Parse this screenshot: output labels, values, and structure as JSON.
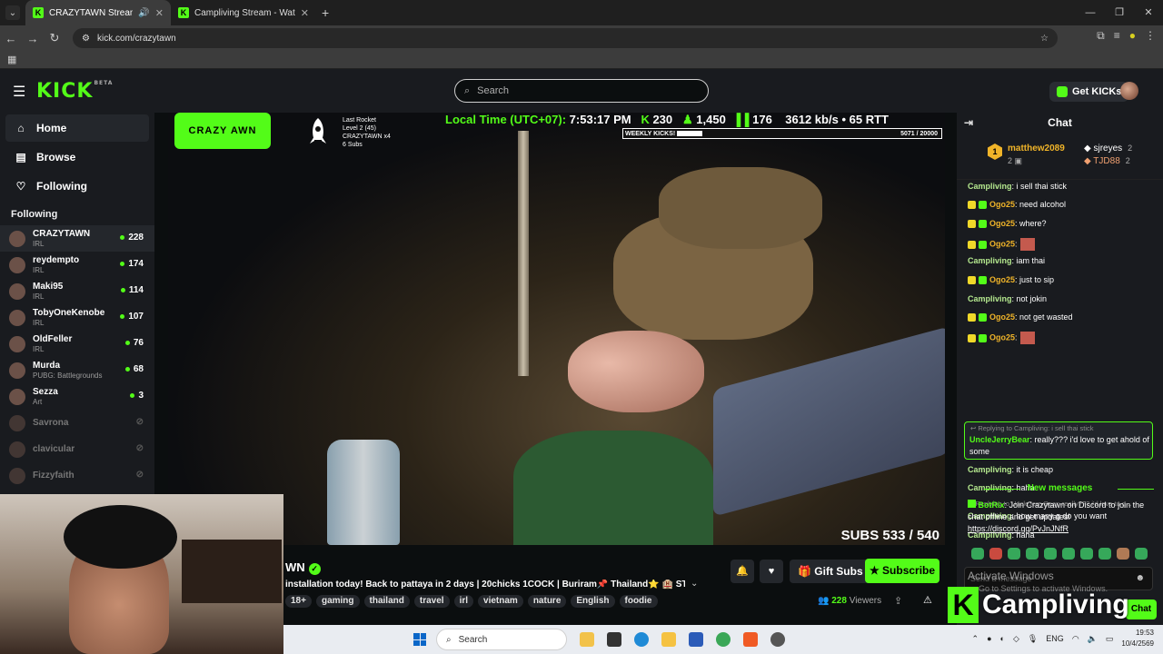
{
  "browser": {
    "tabs": [
      {
        "title": "CRAZYTAWN Stream - Watc",
        "active": true
      },
      {
        "title": "Campliving Stream - Watch Live",
        "active": false
      }
    ],
    "url": "kick.com/crazytawn"
  },
  "header": {
    "logo": "KICK",
    "beta": "BETA",
    "search_placeholder": "Search",
    "get_kicks": "Get KICKs"
  },
  "sidebar": {
    "nav": [
      {
        "label": "Home",
        "icon": "home-icon"
      },
      {
        "label": "Browse",
        "icon": "browse-icon"
      },
      {
        "label": "Following",
        "icon": "heart-icon"
      }
    ],
    "following_title": "Following",
    "channels": [
      {
        "name": "CRAZYTAWN",
        "category": "IRL",
        "viewers": "228",
        "online": true
      },
      {
        "name": "reydempto",
        "category": "IRL",
        "viewers": "174",
        "online": true
      },
      {
        "name": "Maki95",
        "category": "IRL",
        "viewers": "114",
        "online": true
      },
      {
        "name": "TobyOneKenobe",
        "category": "IRL",
        "viewers": "107",
        "online": true
      },
      {
        "name": "OldFeller",
        "category": "IRL",
        "viewers": "76",
        "online": true
      },
      {
        "name": "Murda",
        "category": "PUBG: Battlegrounds",
        "viewers": "68",
        "online": true
      },
      {
        "name": "Sezza",
        "category": "Art",
        "viewers": "3",
        "online": true
      },
      {
        "name": "Savrona",
        "category": "",
        "viewers": "",
        "online": false
      },
      {
        "name": "clavicular",
        "category": "",
        "viewers": "",
        "online": false
      },
      {
        "name": "Fizzyfaith",
        "category": "",
        "viewers": "",
        "online": false
      }
    ]
  },
  "overlay": {
    "logo_text": "CRAZY AWN",
    "last_rocket": [
      "Last Rocket",
      "Level 2 (45)",
      "CRAZYTAWN x4",
      "6 Subs"
    ],
    "local_time_label": "Local Time (UTC+07):",
    "local_time": "7:53:17 PM",
    "kicks": "230",
    "followers": "1,450",
    "viewers": "176",
    "bitrate": "3612 kb/s",
    "rtt": "65 RTT",
    "weekly_label": "WEEKLY KICKS!",
    "weekly_count": "5071 / 20000",
    "weekly_progress": 0.2535,
    "subs": "SUBS 533 / 540"
  },
  "stream": {
    "name": "WN",
    "title": "installation today! Back to pattaya in 2 days | 20chicks 1COCK | Buriram📌 Thailand⭐ 🏨 STAKE....",
    "tags": [
      "18+",
      "gaming",
      "thailand",
      "travel",
      "irl",
      "vietnam",
      "nature",
      "English",
      "foodie"
    ],
    "gift_subs": "Gift Subs",
    "subscribe": "Subscribe",
    "viewers": "228",
    "viewers_label": "Viewers"
  },
  "chat": {
    "title": "Chat",
    "leaderboard": [
      {
        "rank": "1",
        "name": "matthew2089",
        "count": "2"
      },
      {
        "name": "sjreyes",
        "count": "2"
      },
      {
        "name": "TJD88",
        "count": "2"
      }
    ],
    "messages": [
      {
        "user": "Campliving",
        "text": ": i sell thai stick",
        "badges": 0
      },
      {
        "user": "Ogo25",
        "text": ": need alcohol",
        "badges": 2
      },
      {
        "user": "Ogo25",
        "text": ": where?",
        "badges": 2
      },
      {
        "user": "Ogo25",
        "text": ":",
        "badges": 2,
        "emote": true
      },
      {
        "user": "Campliving",
        "text": ": iam thai",
        "badges": 0
      },
      {
        "user": "Ogo25",
        "text": ": just to sip",
        "badges": 2
      },
      {
        "user": "Campliving",
        "text": ": not jokin",
        "badges": 0
      },
      {
        "user": "Ogo25",
        "text": ": not get wasted",
        "badges": 2
      },
      {
        "user": "Ogo25",
        "text": ":",
        "badges": 2,
        "emote": true
      }
    ],
    "reply": {
      "context": "Replying to Campliving: i sell thai stick",
      "user": "UncleJerryBear",
      "text": ": really??? i'd love to get ahold of some"
    },
    "messages2": [
      {
        "user": "Campliving",
        "text": ": it is cheap"
      },
      {
        "user": "Campliving",
        "text": ": haha"
      },
      {
        "context": "Replying to UncleJerryBear: really??? i'd love to g..."
      },
      {
        "user": "Campliving",
        "text": ": how many g do you want"
      },
      {
        "user": "Campliving",
        "text": ": haha"
      }
    ],
    "new_messages": "New messages",
    "bot": {
      "user": "BotRix",
      "text": ": Join Crazytawn on Discord to join the chat offline and get updates!",
      "link": "https://discord.gg/PvJnJNfR"
    },
    "input_placeholder": "Send a message",
    "chat_button": "Chat",
    "activate_windows": "Activate Windows",
    "activate_windows_sub": "Go to Settings to activate Windows.",
    "watermark": "Campliving"
  },
  "taskbar": {
    "search": "Search",
    "lang": "ENG",
    "time": "19:53",
    "date": "10/4/2569"
  }
}
